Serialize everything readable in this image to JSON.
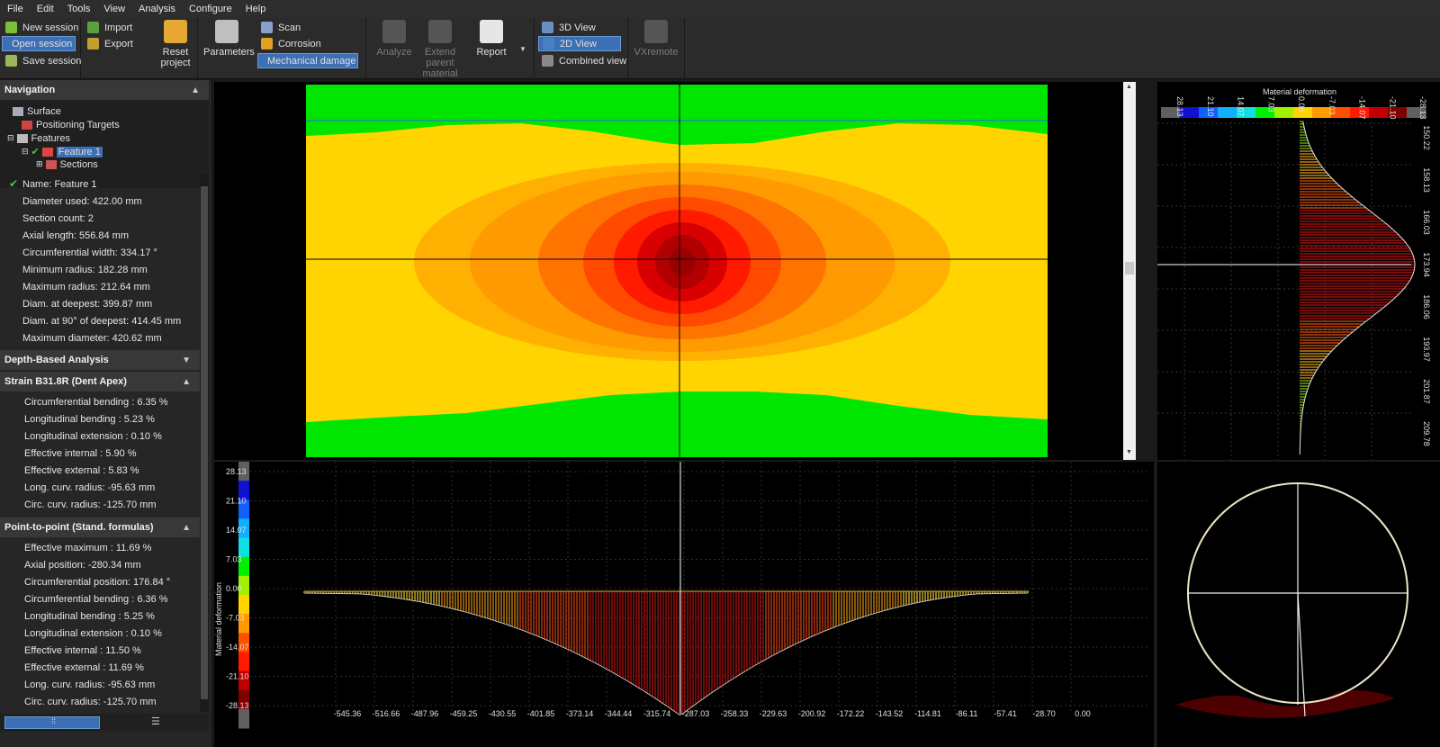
{
  "menu": [
    "File",
    "Edit",
    "Tools",
    "View",
    "Analysis",
    "Configure",
    "Help"
  ],
  "ribbon": {
    "session": {
      "new_session": "New session",
      "open_session": "Open session",
      "save_session": "Save session",
      "import": "Import",
      "export": "Export"
    },
    "reset_project": "Reset project",
    "parameters": "Parameters",
    "modes": {
      "scan": "Scan",
      "corrosion": "Corrosion",
      "mechanical_damage": "Mechanical damage"
    },
    "analyze": "Analyze",
    "extend_parent_material": "Extend parent material",
    "report": "Report",
    "views": {
      "view_3d": "3D View",
      "view_2d": "2D View",
      "combined_view": "Combined view"
    },
    "vxremote": "VXremote"
  },
  "navigation": {
    "title": "Navigation",
    "tree": [
      "Surface",
      "Positioning Targets",
      "Features",
      "Feature 1",
      "Sections"
    ]
  },
  "feature_props": [
    "Name: Feature 1",
    "Diameter used: 422.00 mm",
    "Section count: 2",
    "Axial length: 556.84 mm",
    "Circumferential width: 334.17 °",
    "Minimum radius: 182.28 mm",
    "Maximum radius: 212.64 mm",
    "Diam. at deepest: 399.87 mm",
    "Diam. at 90° of deepest: 414.45 mm",
    "Maximum diameter: 420.62 mm"
  ],
  "sections": {
    "depth_based": "Depth-Based Analysis",
    "strain_title": "Strain B31.8R (Dent Apex)",
    "strain_items": [
      "Circumferential bending : 6.35 %",
      "Longitudinal bending : 5.23 %",
      "Longitudinal extension : 0.10 %",
      "Effective internal : 5.90 %",
      "Effective external : 5.83 %",
      "Long. curv. radius: -95.63 mm",
      "Circ. curv. radius: -125.70 mm"
    ],
    "p2p_title": "Point-to-point (Stand. formulas)",
    "p2p_items": [
      "Effective maximum : 11.69 %",
      "Axial position: -280.34 mm",
      "Circumferential position: 176.84 °",
      "Circumferential bending : 6.36 %",
      "Longitudinal bending : 5.25 %",
      "Longitudinal extension : 0.10 %",
      "Effective internal : 11.50 %",
      "Effective external : 11.69 %",
      "Long. curv. radius: -95.63 mm",
      "Circ. curv. radius: -125.70 mm"
    ]
  },
  "colors": {
    "green": "#00e600",
    "yellow": "#ffd400",
    "orange": "#ff9a00",
    "red": "#ff1a00",
    "darkred": "#990000",
    "selection": "#3c6fb3"
  },
  "right_profile": {
    "title": "Material deformation",
    "scale_labels": [
      "28.13",
      "21.10",
      "14.07",
      "7.03",
      "0.00",
      "-7.03",
      "-14.07",
      "-21.10",
      "-28.13"
    ],
    "axis_labels": [
      "150.22",
      "158.13",
      "166.03",
      "173.94",
      "186.06",
      "193.97",
      "201.87",
      "209.78"
    ]
  },
  "bottom_profile": {
    "ylabel": "Material deformation",
    "yticks": [
      "28.13",
      "21.10",
      "14.07",
      "7.03",
      "0.00",
      "-7.03",
      "-14.07",
      "-21.10",
      "-28.13"
    ],
    "xticks": [
      "-545.36",
      "-516.66",
      "-487.96",
      "-459.25",
      "-430.55",
      "-401.85",
      "-373.14",
      "-344.44",
      "-315.74",
      "-287.03",
      "-258.33",
      "-229.63",
      "-200.92",
      "-172.22",
      "-143.52",
      "-114.81",
      "-86.11",
      "-57.41",
      "-28.70",
      "0.00"
    ]
  }
}
